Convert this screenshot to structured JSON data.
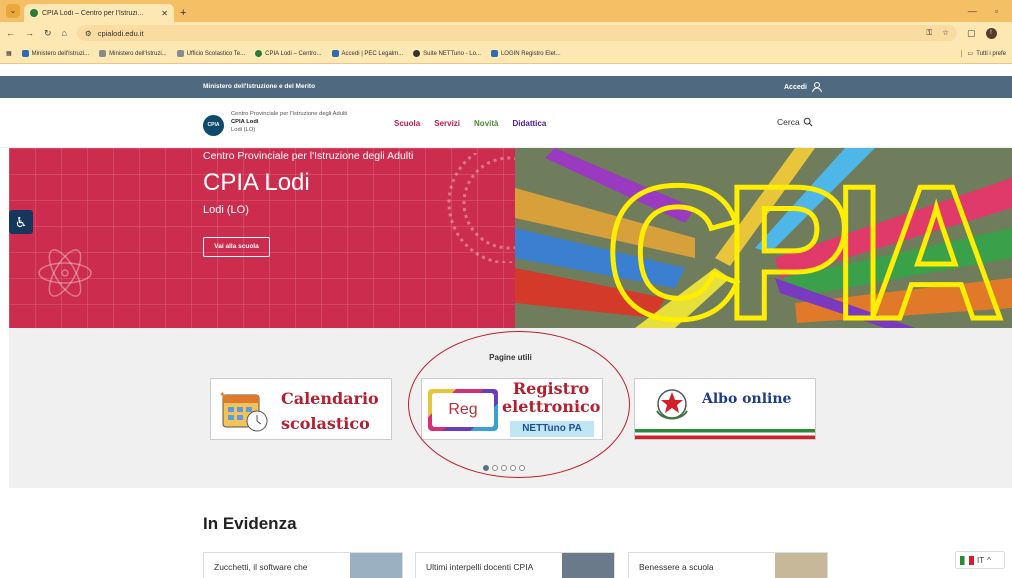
{
  "browser": {
    "tab_title": "CPIA Lodi – Centro per l'Istruzi...",
    "url": "cpialodi.edu.it",
    "bookmarks": [
      "Ministero dell'Istruzi...",
      "Ministero dell'Istruzi...",
      "Ufficio Scolastico Te...",
      "CPIA Lodi – Centro...",
      "Accedi | PEC Legalm...",
      "Suite NETTuno - Lo...",
      "LOGIN Registro Elet..."
    ],
    "bookmarks_right": "Tutti i prefe",
    "avatar_initial": "!"
  },
  "topbar": {
    "ministry": "Ministero dell'Istruzione e del Merito",
    "login": "Accedi"
  },
  "header": {
    "logo_text": "CPIA",
    "brand_line1": "Centro Provinciale per l'Istruzione degli Adulti",
    "brand_line2": "CPIA Lodi",
    "brand_line3": "Lodi (LO)",
    "nav": [
      "Scuola",
      "Servizi",
      "Novità",
      "Didattica"
    ],
    "search": "Cerca"
  },
  "hero": {
    "subtitle": "Centro Provinciale per l'Istruzione degli Adulti",
    "title": "CPIA Lodi",
    "location": "Lodi (LO)",
    "button": "Vai alla scuola",
    "image_text": "CPIA"
  },
  "useful_pages": {
    "title": "Pagine utili",
    "cards": [
      {
        "line1": "Calendario",
        "line2": "scolastico"
      },
      {
        "line1": "Registro",
        "line2": "elettronico",
        "line3": "NETTuno PA",
        "badge": "Reg"
      },
      {
        "line1": "Albo online"
      }
    ],
    "carousel_pages": 5,
    "carousel_active": 1
  },
  "evidence": {
    "title": "In Evidenza",
    "items": [
      "Zucchetti, il software che",
      "Ultimi interpelli docenti CPIA",
      "Benessere a scuola"
    ]
  },
  "language": "IT",
  "colors": {
    "hero_red": "#cc2d4e",
    "topbar": "#4f6a80",
    "highlight_oval": "#c0202a"
  }
}
